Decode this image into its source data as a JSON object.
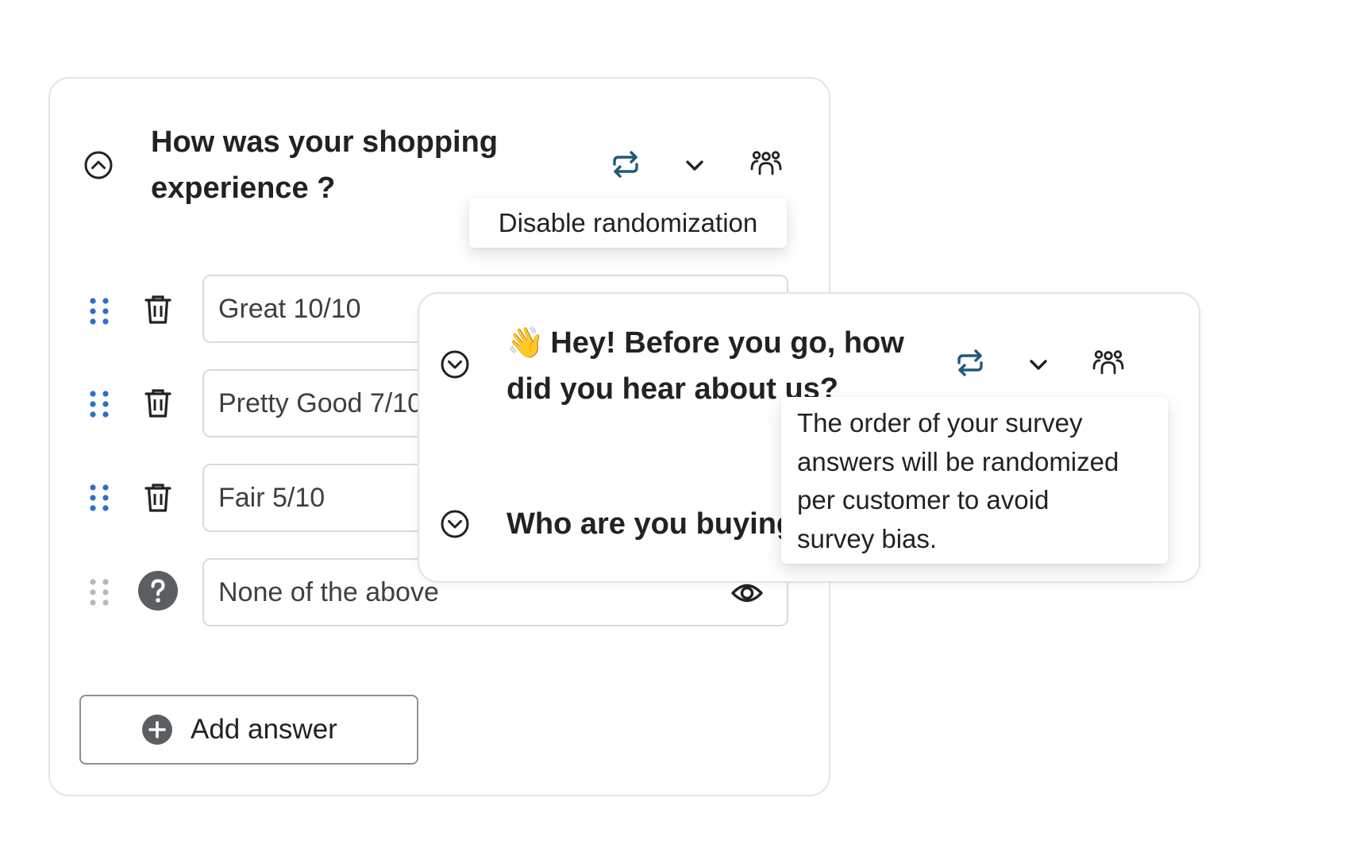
{
  "question1": {
    "title_line1": "How was your shopping",
    "title_line2": "experience ?",
    "answers": [
      {
        "label": "Great 10/10"
      },
      {
        "label": "Pretty Good 7/10"
      },
      {
        "label": "Fair 5/10"
      },
      {
        "label": "None of the above"
      }
    ],
    "add_answer_label": "Add answer"
  },
  "question2": {
    "emoji": "👋",
    "title_line1": "Hey! Before you go, how",
    "title_line2": "did you hear about us?"
  },
  "question3": {
    "title": "Who are you buying"
  },
  "tooltips": {
    "disable_randomization": "Disable randomization",
    "order_line1": "The order of your survey",
    "order_line2": "answers will be randomized",
    "order_line3": "per customer to avoid",
    "order_line4": "survey bias."
  },
  "icons": {
    "collapse": "chevron-up-circle-icon",
    "expand": "chevron-down-circle-icon",
    "randomize": "shuffle-arrows-icon",
    "menu": "chevron-down-icon",
    "audience": "people-group-icon",
    "drag": "drag-handle-icon",
    "delete": "trash-icon",
    "help": "question-mark-icon",
    "visibility": "eye-icon",
    "add": "plus-circle-icon"
  },
  "colors": {
    "drag_handle": "#2c6ecb",
    "drag_handle_muted": "#b5b8bd",
    "randomize_icon": "#1f5a7a",
    "help_badge": "#5c5f62",
    "border": "#e3e4e6"
  }
}
